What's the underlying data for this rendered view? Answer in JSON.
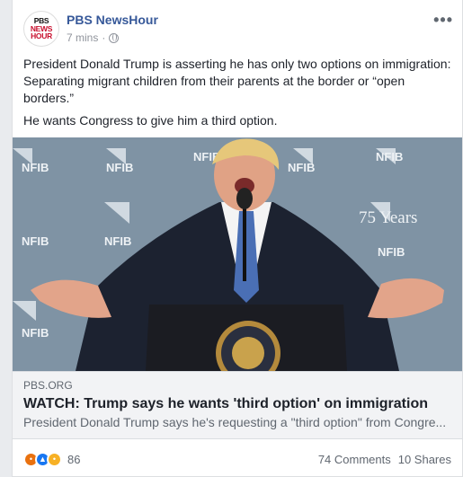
{
  "post": {
    "page_name": "PBS NewsHour",
    "avatar_text": [
      "PBS",
      "NEWS",
      "HOUR"
    ],
    "timestamp": "7 mins",
    "separator": "·",
    "more_label": "•••",
    "paragraphs": [
      "President Donald Trump is asserting he has only two options on immigration: Separating migrant children from their parents at the border or “open borders.”",
      "He wants Congress to give him a third option."
    ]
  },
  "media": {
    "banner_texts": [
      "NFIB",
      "NFIB",
      "NFIB",
      "NFIB",
      "NFIB",
      "NFIB",
      "NFIB",
      "NFIB",
      "NFIB"
    ],
    "years_text": "75 Years",
    "seal_text": "PRESIDENT OF THE UNITED STATES",
    "colors": {
      "backdrop": "#7f93a4",
      "suit": "#1c2230",
      "podium": "#1b1c22",
      "tie": "#4a6fb5"
    }
  },
  "link": {
    "domain": "PBS.ORG",
    "title": "WATCH: Trump says he wants 'third option' on immigration",
    "description": "President Donald Trump says he's requesting a \"third option\" from Congre..."
  },
  "footer": {
    "reaction_count": "86",
    "comments": "74 Comments",
    "shares": "10 Shares"
  }
}
